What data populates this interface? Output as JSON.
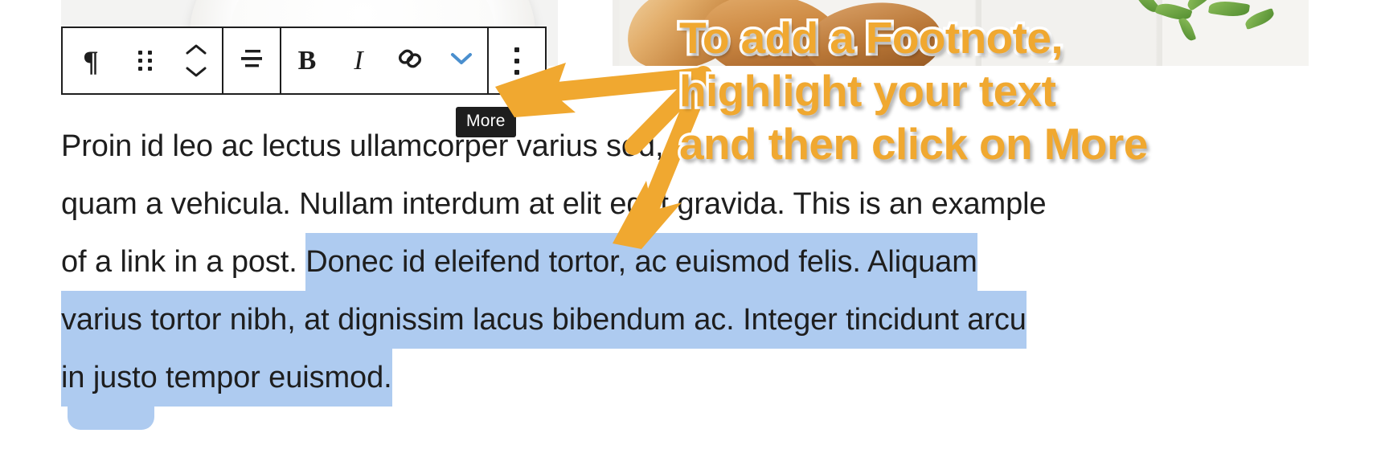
{
  "editor": {
    "toolbar": {
      "groups": [
        {
          "name": "block-controls",
          "buttons": [
            {
              "id": "paragraph",
              "label": "Paragraph",
              "icon": "paragraph-icon",
              "glyph": "¶"
            },
            {
              "id": "drag",
              "label": "Drag",
              "icon": "drag-handle-icon"
            },
            {
              "id": "move",
              "label": "Move up or down",
              "icon": "move-up-down-icon"
            }
          ]
        },
        {
          "name": "alignment",
          "buttons": [
            {
              "id": "align",
              "label": "Align text",
              "icon": "align-text-icon"
            }
          ]
        },
        {
          "name": "formatting",
          "buttons": [
            {
              "id": "bold",
              "label": "Bold",
              "icon": "bold-icon",
              "glyph": "B"
            },
            {
              "id": "italic",
              "label": "Italic",
              "icon": "italic-icon",
              "glyph": "I"
            },
            {
              "id": "link",
              "label": "Link",
              "icon": "link-icon"
            },
            {
              "id": "more-formatting",
              "label": "More",
              "icon": "chevron-down-icon",
              "color": "#4a8fce"
            }
          ]
        },
        {
          "name": "options",
          "buttons": [
            {
              "id": "options",
              "label": "Options",
              "icon": "vertical-ellipsis-icon"
            }
          ]
        }
      ]
    },
    "tooltip": {
      "text": "More"
    },
    "content": {
      "lines": [
        {
          "parts": [
            {
              "text": "Proin id leo ac lectus ullamcorper varius sed,",
              "selected": false
            }
          ]
        },
        {
          "parts": [
            {
              "text": "quam a vehicula. Nullam interdum at elit eget gravida. This is an example",
              "selected": false
            }
          ]
        },
        {
          "parts": [
            {
              "text": "of a link in a post. ",
              "selected": false
            },
            {
              "text": "Donec id eleifend tortor, ac euismod felis. Aliquam",
              "selected": true
            }
          ]
        },
        {
          "parts": [
            {
              "text": "varius tortor nibh, at dignissim lacus bibendum ac. Integer tincidunt arcu",
              "selected": true
            }
          ]
        },
        {
          "parts": [
            {
              "text": "in justo tempor euismod.",
              "selected": true
            }
          ]
        }
      ]
    }
  },
  "annotation": {
    "caption_lines": [
      "To add a Footnote,",
      "highlight your text",
      "and then click on More"
    ],
    "arrow": {
      "name": "double-headed-bent-arrow",
      "color": "#f0a830"
    }
  },
  "colors": {
    "accent_orange": "#f0a830",
    "selection_blue": "#aecbf0",
    "toolbar_border": "#1e1e1e",
    "tooltip_bg": "#1e1e1e",
    "chevron_blue": "#4a8fce",
    "text": "#1e1e1e"
  }
}
